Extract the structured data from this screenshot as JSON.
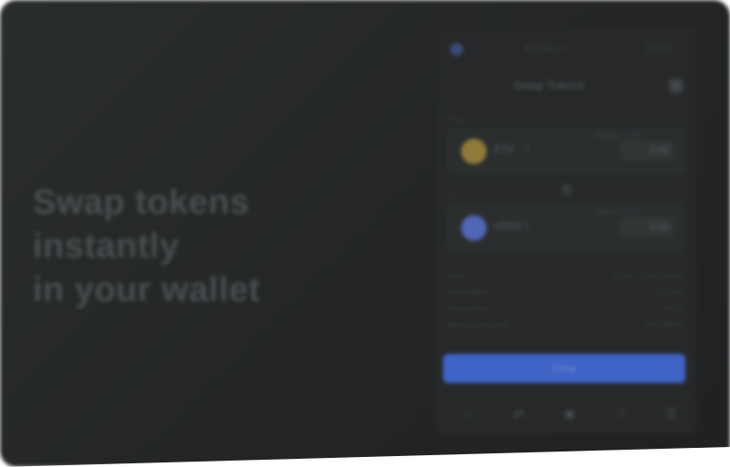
{
  "hero": {
    "line1": "Swap tokens",
    "line2": "instantly",
    "line3": "in your wallet"
  },
  "wallet": {
    "network_label": "· ·",
    "account_label": "Account 1",
    "address_label": "0x1a2…",
    "title": "Swap Tokens",
    "from_label": "From",
    "to_label": "To",
    "from": {
      "symbol": "ETH",
      "balance_label": "Balance: 1.24",
      "amount": "0.00",
      "coin_color": "#8f7a3a"
    },
    "to": {
      "symbol": "USDC",
      "balance_label": "Balance: 0.00",
      "amount": "0.00",
      "coin_color": "#5166b4"
    },
    "details": [
      {
        "key": "Rate",
        "value": "1 ETH = 3,240 USDC"
      },
      {
        "key": "Price impact",
        "value": "< 0.01%"
      },
      {
        "key": "Network fee",
        "value": "$1.23"
      },
      {
        "key": "Minimum received",
        "value": "0.00 USDC"
      }
    ],
    "swap_button": "Swap",
    "nav": [
      "⌂",
      "⇄",
      "▣",
      "⏱",
      "☰"
    ]
  },
  "colors": {
    "accent": "#3f63c6",
    "background": "#232526"
  }
}
